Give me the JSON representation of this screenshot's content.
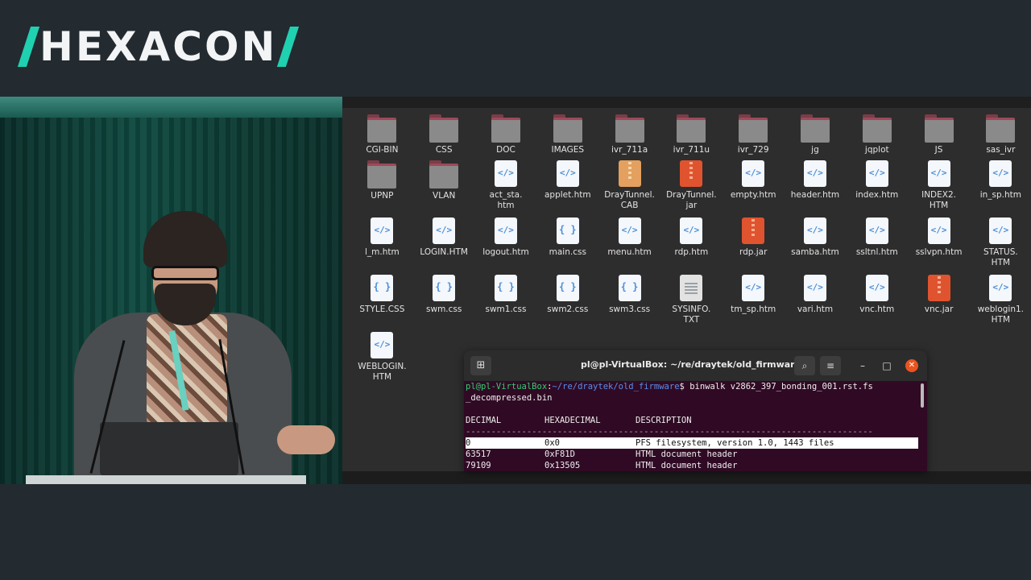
{
  "logo": {
    "text": "HEXACON"
  },
  "files": {
    "rows": [
      [
        {
          "label": "CGI-BIN",
          "type": "folder"
        },
        {
          "label": "CSS",
          "type": "folder"
        },
        {
          "label": "DOC",
          "type": "folder"
        },
        {
          "label": "IMAGES",
          "type": "folder"
        },
        {
          "label": "ivr_711a",
          "type": "folder"
        },
        {
          "label": "ivr_711u",
          "type": "folder"
        },
        {
          "label": "ivr_729",
          "type": "folder"
        },
        {
          "label": "jg",
          "type": "folder"
        },
        {
          "label": "jqplot",
          "type": "folder"
        },
        {
          "label": "JS",
          "type": "folder"
        },
        {
          "label": "sas_ivr",
          "type": "folder"
        }
      ],
      [
        {
          "label": "UPNP",
          "type": "folder"
        },
        {
          "label": "VLAN",
          "type": "folder"
        },
        {
          "label": "act_sta.\nhtm",
          "type": "html"
        },
        {
          "label": "applet.htm",
          "type": "html"
        },
        {
          "label": "DrayTunnel.\nCAB",
          "type": "cab"
        },
        {
          "label": "DrayTunnel.\njar",
          "type": "jar"
        },
        {
          "label": "empty.htm",
          "type": "html"
        },
        {
          "label": "header.htm",
          "type": "html"
        },
        {
          "label": "index.htm",
          "type": "html"
        },
        {
          "label": "INDEX2.\nHTM",
          "type": "html"
        },
        {
          "label": "in_sp.htm",
          "type": "html"
        }
      ],
      [
        {
          "label": "l_m.htm",
          "type": "html"
        },
        {
          "label": "LOGIN.HTM",
          "type": "html"
        },
        {
          "label": "logout.htm",
          "type": "html"
        },
        {
          "label": "main.css",
          "type": "css"
        },
        {
          "label": "menu.htm",
          "type": "html"
        },
        {
          "label": "rdp.htm",
          "type": "html"
        },
        {
          "label": "rdp.jar",
          "type": "jar"
        },
        {
          "label": "samba.htm",
          "type": "html"
        },
        {
          "label": "ssltnl.htm",
          "type": "html"
        },
        {
          "label": "sslvpn.htm",
          "type": "html"
        },
        {
          "label": "STATUS.\nHTM",
          "type": "html"
        }
      ],
      [
        {
          "label": "STYLE.CSS",
          "type": "css"
        },
        {
          "label": "swm.css",
          "type": "css"
        },
        {
          "label": "swm1.css",
          "type": "css"
        },
        {
          "label": "swm2.css",
          "type": "css"
        },
        {
          "label": "swm3.css",
          "type": "css"
        },
        {
          "label": "SYSINFO.\nTXT",
          "type": "txt"
        },
        {
          "label": "tm_sp.htm",
          "type": "html"
        },
        {
          "label": "vari.htm",
          "type": "html"
        },
        {
          "label": "vnc.htm",
          "type": "html"
        },
        {
          "label": "vnc.jar",
          "type": "jar"
        },
        {
          "label": "weblogin1.\nHTM",
          "type": "html"
        }
      ],
      [
        {
          "label": "WEBLOGIN.\nHTM",
          "type": "html"
        }
      ]
    ]
  },
  "terminal": {
    "title": "pl@pl-VirtualBox: ~/re/draytek/old_firmware",
    "new_tab_icon": "⊞",
    "search_icon": "⌕",
    "menu_icon": "≡",
    "minimize_icon": "–",
    "maximize_icon": "□",
    "close_icon": "✕",
    "prompt_user": "pl@pl-VirtualBox",
    "prompt_sep": ":",
    "prompt_path": "~/re/draytek/old_firmware",
    "prompt_dollar": "$ ",
    "command_line1": "binwalk v2862_397_bonding_001.rst.fs",
    "command_line2": "_decompressed.bin",
    "headers": [
      "DECIMAL",
      "HEXADECIMAL",
      "DESCRIPTION"
    ],
    "separator": "--------------------------------------------------------------------------------",
    "rows": [
      {
        "decimal": "0",
        "hex": "0x0",
        "desc": "PFS filesystem, version 1.0, 1443 files"
      },
      {
        "decimal": "63517",
        "hex": "0xF81D",
        "desc": "HTML document header"
      },
      {
        "decimal": "79109",
        "hex": "0x13505",
        "desc": "HTML document header"
      }
    ]
  }
}
